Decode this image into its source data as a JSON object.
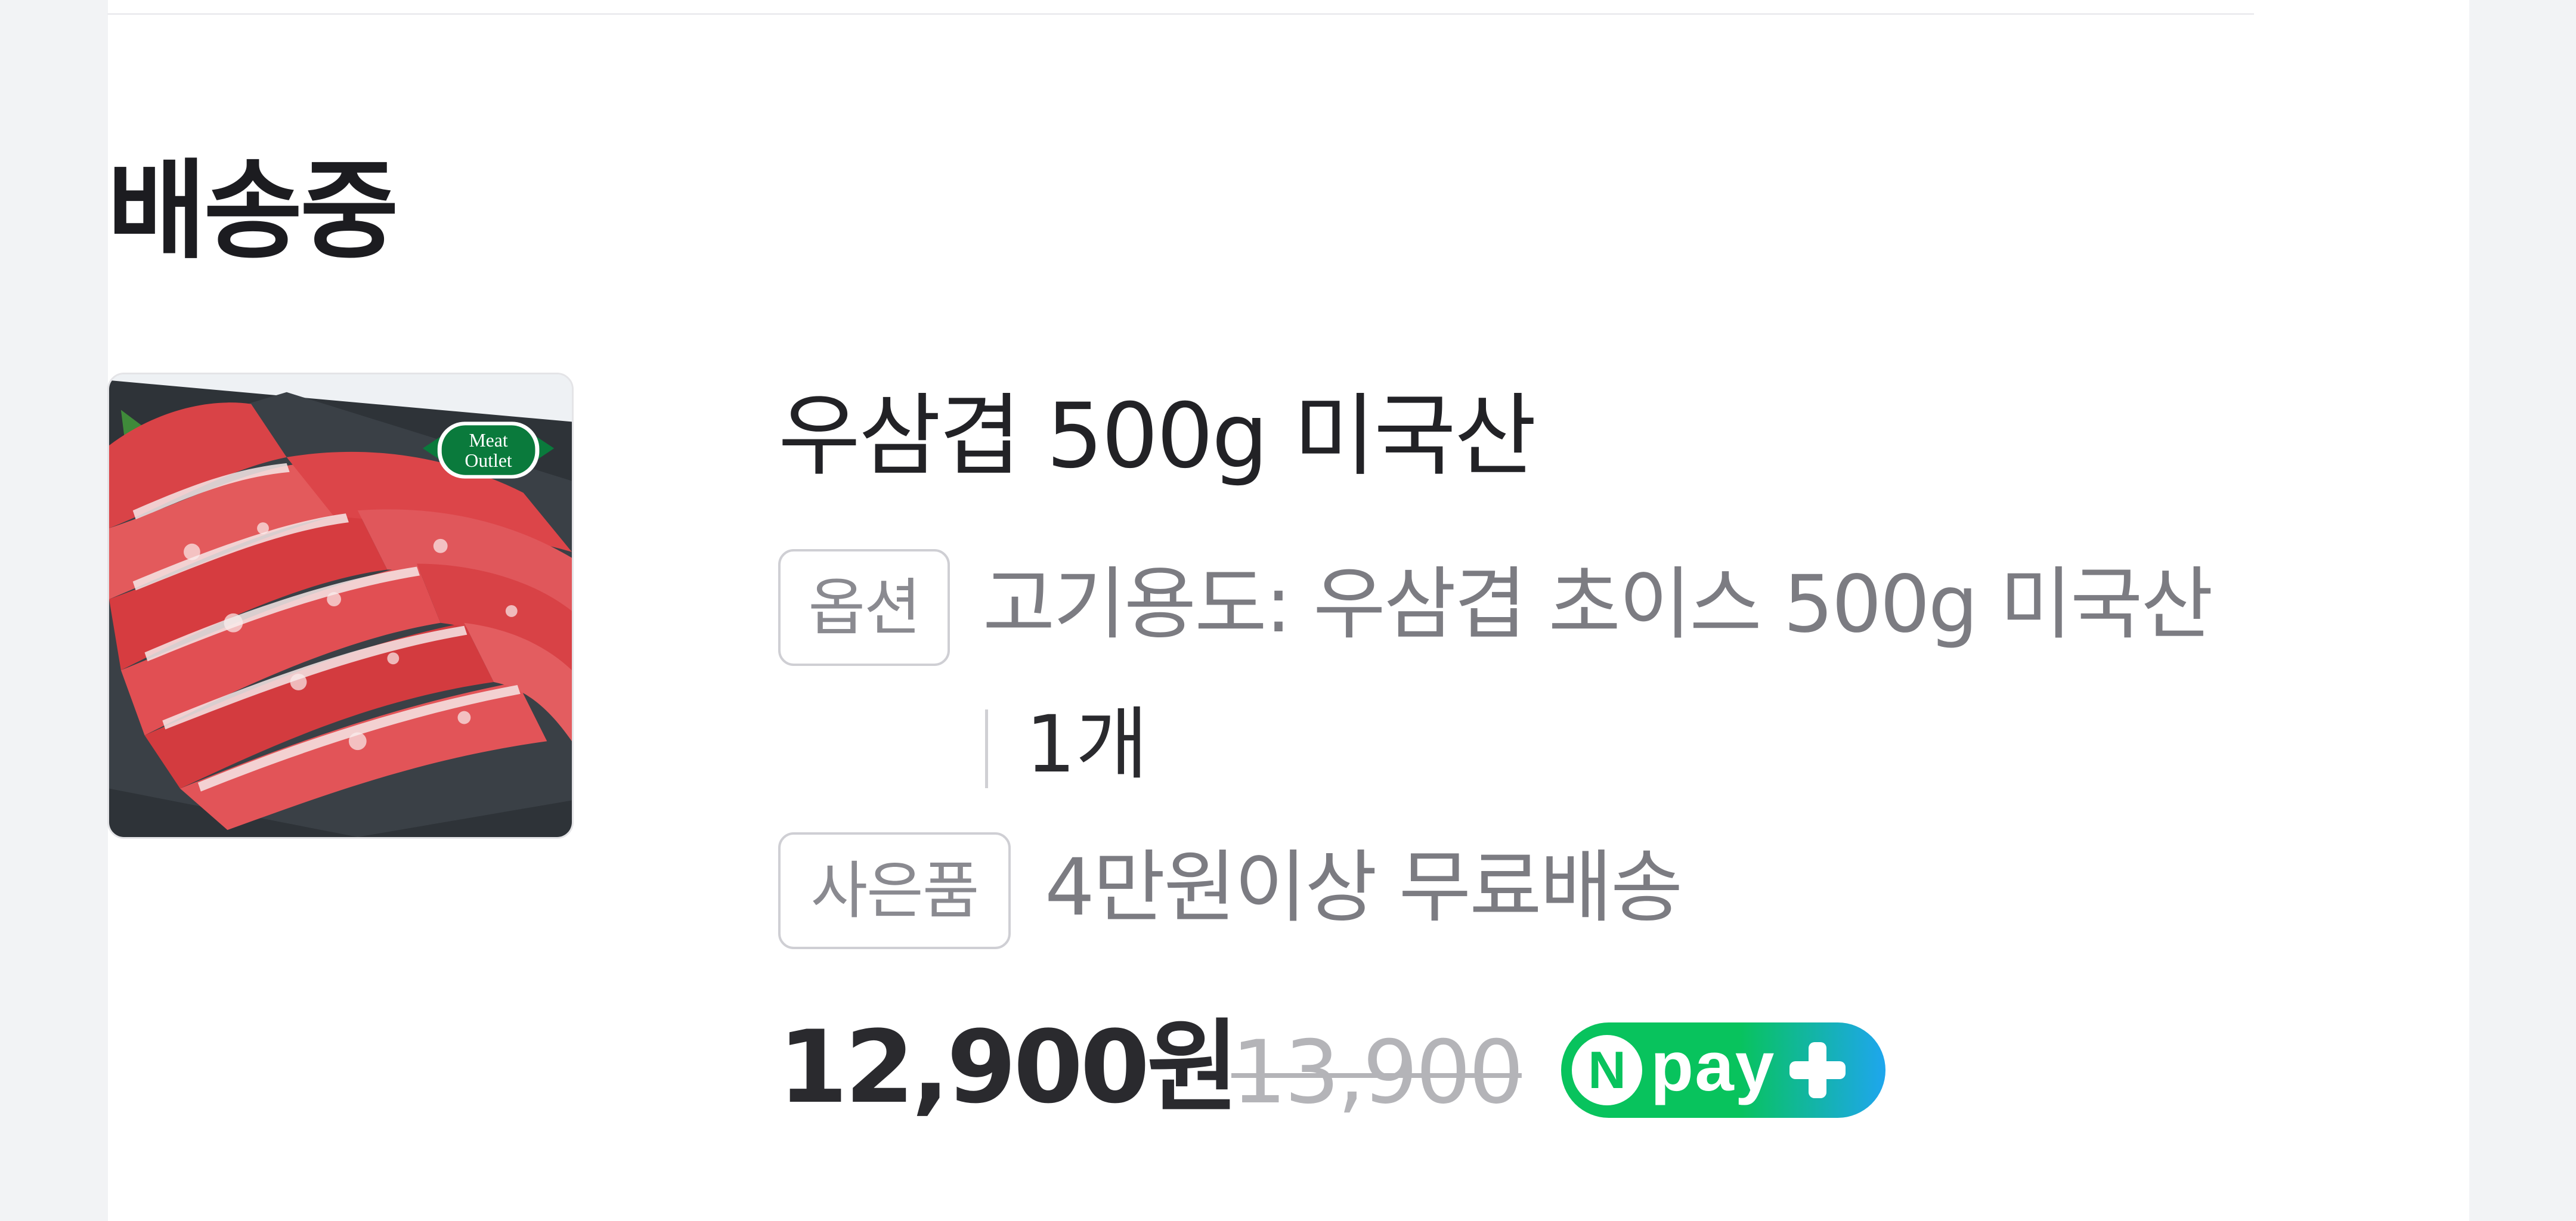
{
  "section": {
    "status_title": "배송중"
  },
  "product": {
    "name": "우삼겹 500g 미국산",
    "thumbnail_logo": "Meat Outlet",
    "option_tag": "옵션",
    "option_text": "고기용도: 우삼겹 초이스 500g 미국산",
    "quantity": "1개",
    "gift_tag": "사은품",
    "gift_text": "4만원이상 무료배송",
    "price": "12,900원",
    "original_price": "13,900"
  },
  "npay": {
    "n_letter": "N",
    "label": "pay",
    "icon": "plus-icon"
  },
  "colors": {
    "npay_green": "#08c35d",
    "npay_blue": "#1ea6ee",
    "logo_green": "#0a7a3c",
    "meat_red": "#d83a3e"
  }
}
